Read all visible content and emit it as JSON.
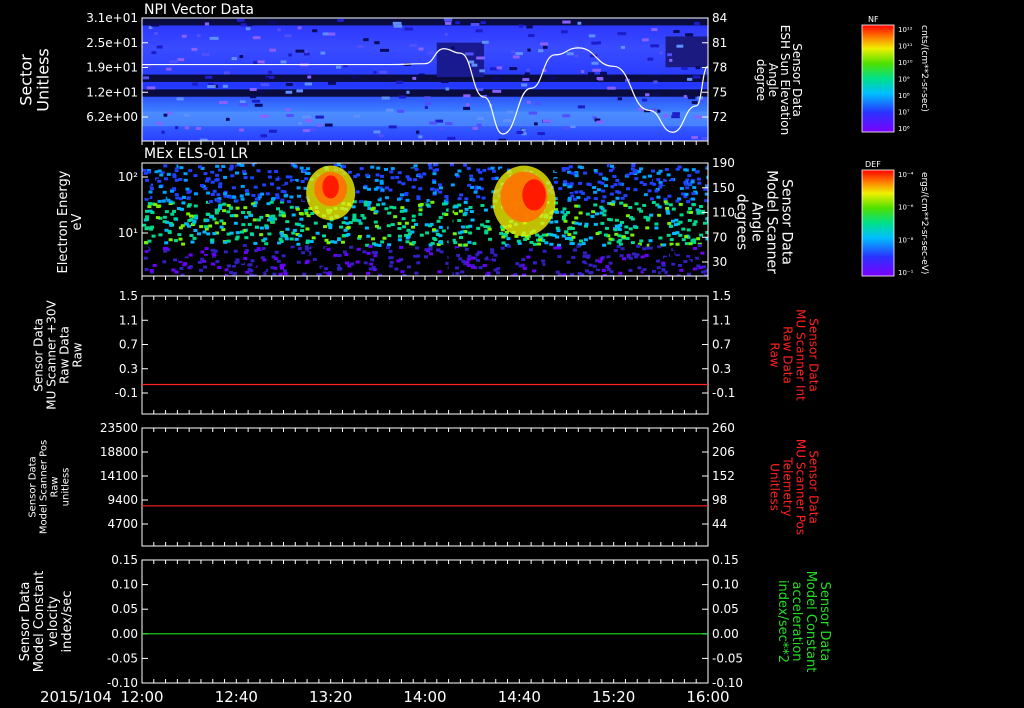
{
  "date_label": "2015/104",
  "time_ticks": [
    "12:00",
    "12:40",
    "13:20",
    "14:00",
    "14:40",
    "15:20",
    "16:00"
  ],
  "colors": {
    "background": "#000000",
    "axis": "#ffffff",
    "red_trace": "#ff2020",
    "green_trace": "#22dd22"
  },
  "chart_data": [
    {
      "id": "npi",
      "type": "heatmap",
      "title": "NPI Vector Data",
      "ylabel_lines": [
        "Sector",
        "Unitless"
      ],
      "yticks": [
        "3.1e+01",
        "2.5e+01",
        "1.9e+01",
        "1.2e+01",
        "6.2e+00"
      ],
      "right_label_lines": [
        "Sensor Data",
        "ESH Sun Elevation",
        "Angle",
        "degree"
      ],
      "right_ticks": [
        "84",
        "81",
        "78",
        "75",
        "72"
      ],
      "right_ylim": [
        70,
        84
      ],
      "overlay_line": {
        "color": "#ffffff",
        "x": [
          "12:00",
          "12:30",
          "13:10",
          "13:45",
          "14:00",
          "14:08",
          "14:15",
          "14:25",
          "14:33",
          "14:45",
          "14:55",
          "15:05",
          "15:20",
          "15:35",
          "15:45",
          "15:55",
          "16:00"
        ],
        "y": [
          78.7,
          78.7,
          78.7,
          78.7,
          78.8,
          80.5,
          80.0,
          75.0,
          70.8,
          76.0,
          79.8,
          80.6,
          78.5,
          73.5,
          71.0,
          74.0,
          78.5
        ]
      },
      "colorbar": {
        "label": "NF",
        "units": "cnts/(cm**2-sr-sec)",
        "tick_labels": [
          "10¹²",
          "10¹¹",
          "10¹⁰",
          "10⁹",
          "10⁸",
          "10⁷",
          "10⁶"
        ]
      }
    },
    {
      "id": "els",
      "type": "heatmap",
      "title": "MEx ELS-01 LR",
      "ylabel_lines": [
        "Electron Energy",
        "eV"
      ],
      "yticks": [
        "10²",
        "10¹"
      ],
      "right_label_lines": [
        "Sensor Data",
        "Model Scanner",
        "Angle",
        "degrees"
      ],
      "right_ticks": [
        "190",
        "150",
        "110",
        "70",
        "30"
      ],
      "hot_regions": [
        {
          "start": "13:13",
          "end": "13:27",
          "energy_min_eV": 20,
          "energy_max_eV": 150
        },
        {
          "start": "14:32",
          "end": "14:52",
          "energy_min_eV": 10,
          "energy_max_eV": 150
        }
      ],
      "colorbar": {
        "label": "DEF",
        "units": "ergs/(cm**2-sr-sec-eV)",
        "tick_labels": [
          "10⁻⁴",
          "10⁻⁶",
          "10⁻⁸",
          "10⁻¹"
        ]
      }
    },
    {
      "id": "mu_raw",
      "type": "line",
      "ylabel_lines": [
        "Sensor Data",
        "MU Scanner +30V",
        "Raw Data",
        "Raw"
      ],
      "yticks": [
        "1.5",
        "1.1",
        "0.7",
        "0.3",
        "-0.1"
      ],
      "ylim": [
        -0.5,
        1.5
      ],
      "right_label_lines": [
        "Sensor Data",
        "MU Scanner Int",
        "Raw Data",
        "Raw"
      ],
      "right_ticks": [
        "1.5",
        "1.1",
        "0.7",
        "0.3",
        "-0.1"
      ],
      "series": [
        {
          "color": "#ff2020",
          "x": [
            "12:00",
            "16:00"
          ],
          "y": [
            0.0,
            0.0
          ]
        }
      ]
    },
    {
      "id": "mu_pos",
      "type": "line",
      "ylabel_lines": [
        "Sensor Data",
        "Model Scanner Pos",
        "Raw",
        "unitless"
      ],
      "yticks": [
        "23500",
        "18800",
        "14100",
        "9400",
        "4700"
      ],
      "ylim": [
        0,
        23500
      ],
      "right_label_lines": [
        "Sensor Data",
        "MU Scanner Pos",
        "Telemetry",
        "Unitless"
      ],
      "right_ticks": [
        "260",
        "206",
        "152",
        "98",
        "44"
      ],
      "series": [
        {
          "color": "#ff2020",
          "x": [
            "12:00",
            "16:00"
          ],
          "y": [
            8000,
            8000
          ]
        }
      ]
    },
    {
      "id": "model_const",
      "type": "line",
      "ylabel_lines": [
        "Sensor Data",
        "Model Constant",
        "velocity",
        "index/sec"
      ],
      "yticks": [
        "0.15",
        "0.10",
        "0.05",
        "0.00",
        "-0.05",
        "-0.10"
      ],
      "ylim": [
        -0.1,
        0.15
      ],
      "right_label_lines": [
        "Sensor Data",
        "Model Constant",
        "acceleration",
        "index/sec**2"
      ],
      "right_ticks": [
        "0.15",
        "0.10",
        "0.05",
        "0.00",
        "-0.05",
        "-0.10"
      ],
      "series": [
        {
          "color": "#22dd22",
          "x": [
            "12:00",
            "16:00"
          ],
          "y": [
            0.0,
            0.0
          ]
        }
      ]
    }
  ]
}
